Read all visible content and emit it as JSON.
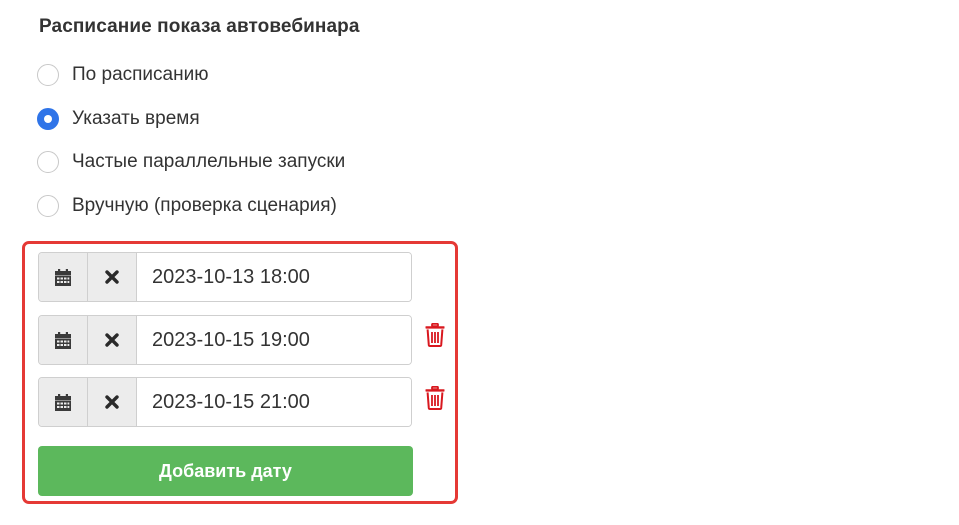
{
  "schedule": {
    "title": "Расписание показа автовебинара",
    "options": [
      {
        "label": "По расписанию",
        "checked": false
      },
      {
        "label": "Указать время",
        "checked": true
      },
      {
        "label": "Частые параллельные запуски",
        "checked": false
      },
      {
        "label": "Вручную (проверка сценария)",
        "checked": false
      }
    ]
  },
  "dates": [
    {
      "value": "2023-10-13 18:00",
      "deletable": false
    },
    {
      "value": "2023-10-15 19:00",
      "deletable": true
    },
    {
      "value": "2023-10-15 21:00",
      "deletable": true
    }
  ],
  "icons": {
    "calendar": "calendar-icon",
    "clear": "close-icon",
    "delete": "trash-icon"
  },
  "add_button_label": "Добавить дату",
  "colors": {
    "accent_blue": "#2f74e8",
    "highlight_red": "#e53935",
    "button_green": "#5cb85c",
    "trash_red": "#d9181f"
  }
}
